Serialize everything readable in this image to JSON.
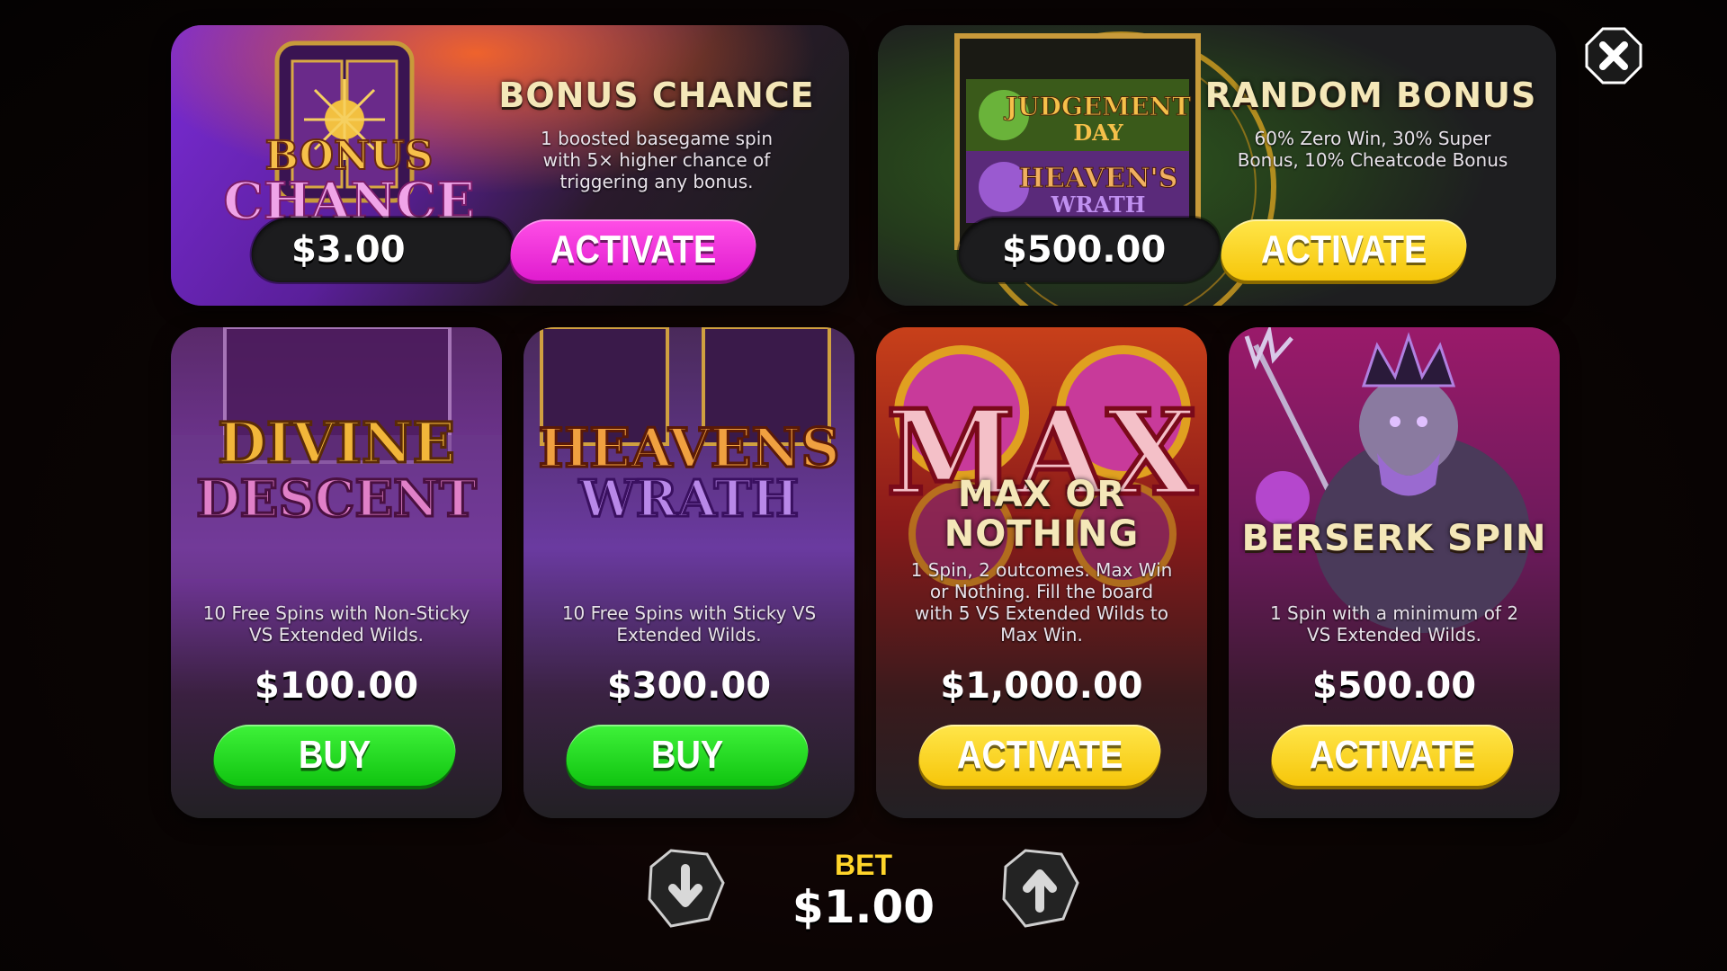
{
  "close_icon": "close-x-icon",
  "top_cards": [
    {
      "title": "BONUS CHANCE",
      "description": "1 boosted basegame spin with 5× higher chance of triggering any bonus.",
      "desc_lines": [
        "1 boosted basegame spin",
        "with 5× higher chance of",
        "triggering any bonus."
      ],
      "art_logo": [
        "BONUS",
        "CHANCE"
      ],
      "price": "$3.00",
      "button": "ACTIVATE",
      "button_color": "#f22ee0"
    },
    {
      "title": "RANDOM BONUS",
      "description": "60% Zero Win, 30% Super Bonus, 10% Cheatcode Bonus",
      "desc_lines": [
        "60% Zero Win, 30% Super",
        "Bonus, 10% Cheatcode Bonus"
      ],
      "art_logo": [
        "JUDGEMENT",
        "DAY",
        "HEAVEN'S",
        "WRATH"
      ],
      "price": "$500.00",
      "button": "ACTIVATE",
      "button_color": "#fbd81e"
    }
  ],
  "bottom_cards": [
    {
      "art_logo": [
        "DIVINE",
        "DESCENT"
      ],
      "title": "",
      "desc_lines": [
        "10 Free Spins with Non-Sticky",
        "VS Extended Wilds."
      ],
      "price": "$100.00",
      "button": "BUY",
      "button_color": "#22d91c"
    },
    {
      "art_logo": [
        "HEAVENS",
        "WRATH"
      ],
      "title": "",
      "desc_lines": [
        "10 Free Spins with Sticky VS",
        "Extended Wilds."
      ],
      "price": "$300.00",
      "button": "BUY",
      "button_color": "#22d91c"
    },
    {
      "art_logo": [
        "MAX"
      ],
      "title_lines": [
        "MAX OR",
        "NOTHING"
      ],
      "desc_lines": [
        "1 Spin, 2 outcomes. Max Win",
        "or Nothing. Fill the board",
        "with 5 VS Extended Wilds to",
        "Max Win."
      ],
      "price": "$1,000.00",
      "button": "ACTIVATE",
      "button_color": "#fbd81e"
    },
    {
      "art_logo": [],
      "title": "BERSERK SPIN",
      "desc_lines": [
        "1 Spin with a minimum of 2",
        "VS Extended Wilds."
      ],
      "price": "$500.00",
      "button": "ACTIVATE",
      "button_color": "#fbd81e"
    }
  ],
  "bet": {
    "label": "BET",
    "value": "$1.00",
    "decrease_icon": "arrow-down-icon",
    "increase_icon": "arrow-up-icon"
  }
}
